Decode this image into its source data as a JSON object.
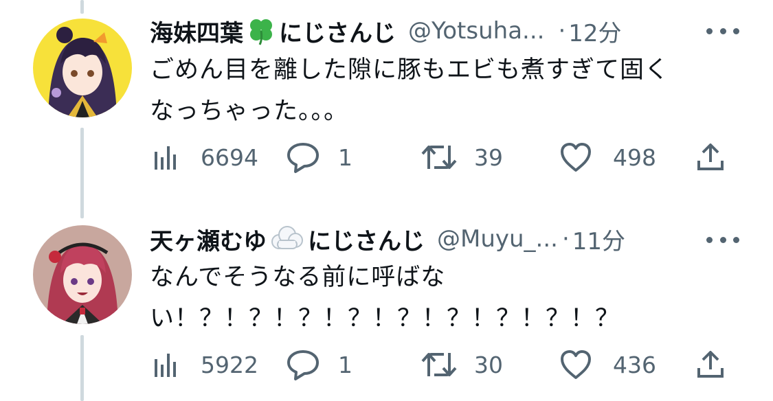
{
  "tweets": [
    {
      "display_name": "海妹四葉",
      "name_emoji": "four-leaf-clover",
      "team": "にじさんじ",
      "handle": "@Yotsuha...",
      "dot": "·",
      "time": "12分",
      "lines": [
        "ごめん目を離した隙に豚もエビも煮すぎて固く",
        "なっちゃった。。。"
      ],
      "views": "6694",
      "replies": "1",
      "retweets": "39",
      "likes": "498",
      "avatar_bg": "#f7e13a"
    },
    {
      "display_name": "天ヶ瀬むゆ",
      "name_emoji": "cloud",
      "team": "にじさんじ",
      "handle": "@Muyu_...",
      "dot": "·",
      "time": "11分",
      "lines": [
        "なんでそうなる前に呼ばな",
        "い！？！？！？！？！？！？！？！？！？"
      ],
      "views": "5922",
      "replies": "1",
      "retweets": "30",
      "likes": "436",
      "avatar_bg": "#c8a79e"
    }
  ],
  "colors": {
    "text": "#0f1419",
    "secondary": "#536471",
    "thread_line": "#cfd9de"
  },
  "icons": [
    "views-icon",
    "reply-icon",
    "retweet-icon",
    "like-icon",
    "share-icon",
    "more-icon"
  ]
}
